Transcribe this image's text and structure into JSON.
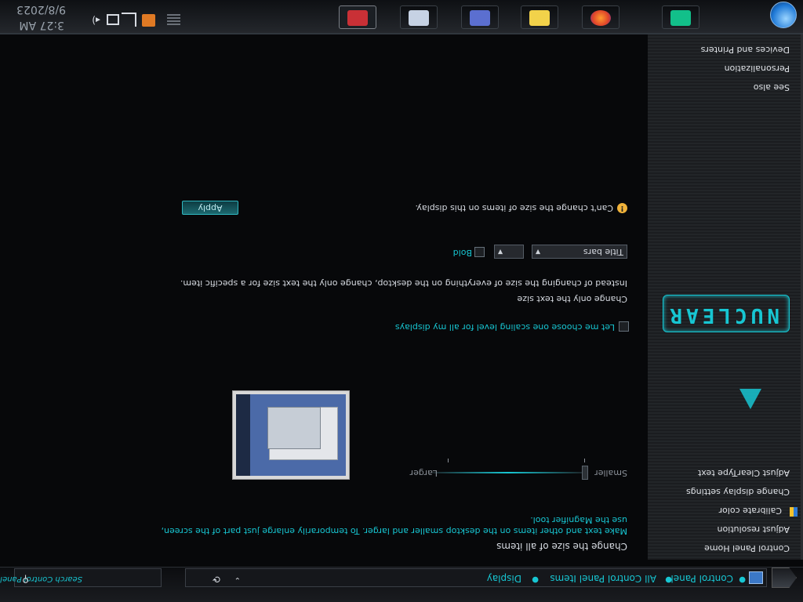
{
  "breadcrumb": [
    "Control Panel",
    "All Control Panel Items",
    "Display"
  ],
  "search_placeholder": "Search Control Panel",
  "sidebar": {
    "items": [
      "Control Panel Home",
      "Adjust resolution",
      "Calibrate color",
      "Change display settings",
      "Adjust ClearType text"
    ],
    "see_also_header": "See also",
    "see_also": [
      "Personalization",
      "Devices and Printers"
    ],
    "logo_text": "NUCLEAR"
  },
  "main": {
    "heading": "Change the size of all items",
    "description_line1": "Make text and other items on the desktop smaller and larger. To temporarily enlarge just part of the screen,",
    "description_line2": "use the Magnifier tool.",
    "slider_smaller": "Smaller",
    "slider_larger": "Larger",
    "scaling_checkbox": "Let me choose one scaling level for all my displays",
    "text_size_heading": "Change only the text size",
    "text_size_desc": "Instead of changing the size of everything on the desktop, change only the text size for a specific item.",
    "item_select": "Title bars",
    "size_select": "",
    "bold_label": "Bold",
    "warning": "Can't change the size of items on this display.",
    "apply": "Apply"
  },
  "tray": {
    "time": "3:27 AM",
    "date": "9/8/2023"
  },
  "colors": {
    "accent": "#17c6d2",
    "bg": "#07080a"
  },
  "icons": [
    "control-panel-icon",
    "refresh-icon",
    "search-icon",
    "warning-icon",
    "windows-orb-icon",
    "firefox-icon",
    "notes-icon",
    "folder-icon",
    "mail-icon",
    "chart-icon",
    "terminal-icon"
  ]
}
